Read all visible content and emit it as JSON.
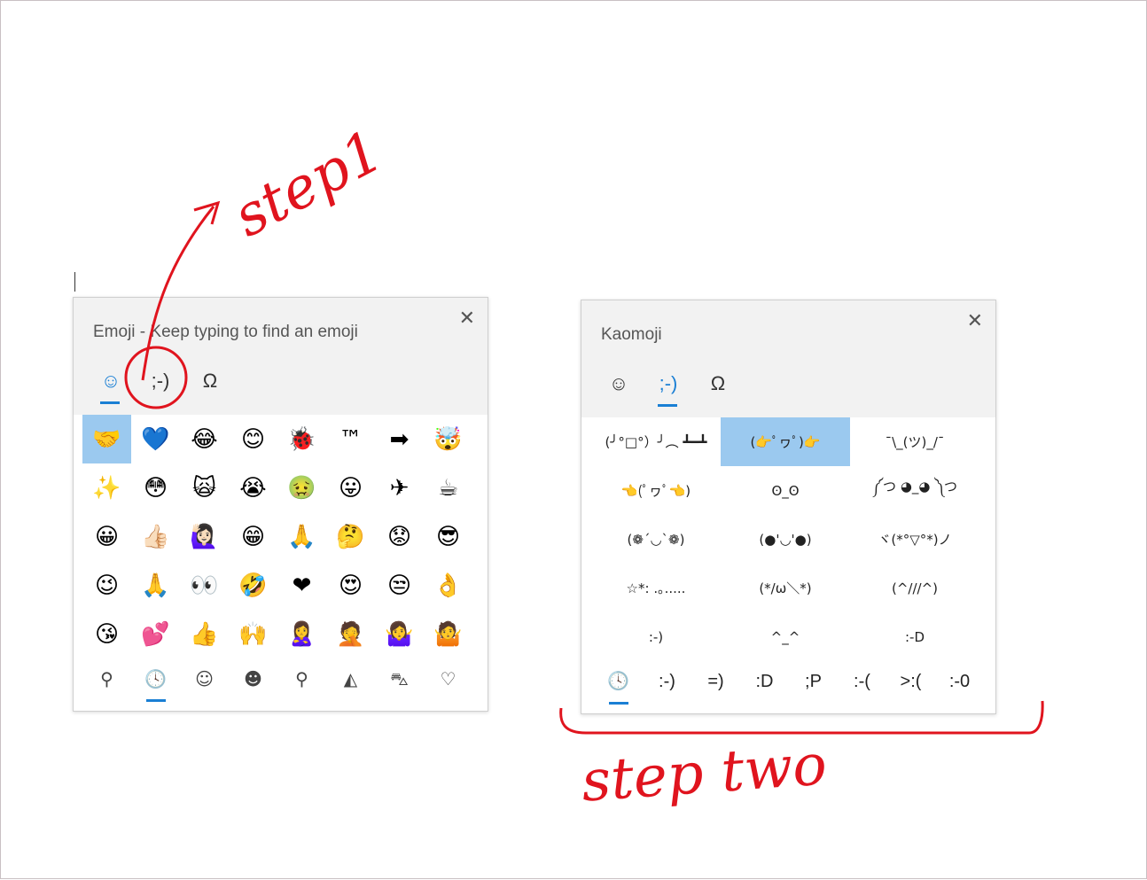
{
  "emoji_panel": {
    "title": "Emoji - Keep typing to find an emoji",
    "close_label": "✕",
    "tabs": [
      {
        "label": "☺",
        "icon": "smiley-icon",
        "active": true
      },
      {
        "label": ";-)",
        "icon": "kaomoji",
        "active": false
      },
      {
        "label": "Ω",
        "icon": "omega-symbols-icon",
        "active": false
      }
    ],
    "emojis": [
      "🤝",
      "💙",
      "😂",
      "😊",
      "🐞",
      "™",
      "➡",
      "🤯",
      "✨",
      "😳",
      "🙀",
      "😭",
      "🤢",
      "😛",
      "✈",
      "☕",
      "😀",
      "👍🏻",
      "🙋🏻‍♀️",
      "😁",
      "🙏",
      "🤔",
      "😟",
      "😎",
      "😉",
      "🙏",
      "👀",
      "🤣",
      "❤",
      "😍",
      "😒",
      "👌",
      "😘",
      "💕",
      "👍",
      "🙌",
      "🙎‍♀️",
      "🤦",
      "🤷‍♀️",
      "🤷"
    ],
    "selected_index": 0,
    "nav": [
      {
        "label": "⚲",
        "icon": "search-icon"
      },
      {
        "label": "🕓",
        "icon": "clock-icon",
        "active": true
      },
      {
        "label": "☺",
        "icon": "smiley-icon"
      },
      {
        "label": "☻",
        "icon": "person-icon"
      },
      {
        "label": "⚲",
        "icon": "location-pin-icon"
      },
      {
        "label": "◭",
        "icon": "pizza-icon"
      },
      {
        "label": "⛍",
        "icon": "car-icon"
      },
      {
        "label": "♡",
        "icon": "heart-icon"
      }
    ]
  },
  "kaomoji_panel": {
    "title": "Kaomoji",
    "close_label": "✕",
    "tabs": [
      {
        "label": "☺",
        "icon": "smiley-icon",
        "active": false
      },
      {
        "label": ";-)",
        "icon": "kaomoji",
        "active": true
      },
      {
        "label": "Ω",
        "icon": "omega-symbols-icon",
        "active": false
      }
    ],
    "items": [
      "(╯°□°）╯︵ ┻━┻",
      "(👉ﾟヮﾟ)👉",
      "¯\\_(ツ)_/¯",
      "👈(ﾟヮﾟ👈)",
      "ʘ‿ʘ",
      "༼つ ◕_◕ ༽つ",
      "(❁´◡`❁)",
      "(●'◡'●)",
      "ヾ(*°▽°*)ノ",
      "☆*: .｡. o(≧▽≦)o .｡.:*☆",
      "(*/ω＼*)",
      "(^///^)",
      ":-)",
      "^_^",
      ":-D"
    ],
    "items_display": [
      "(╯°□°）╯︵ ┻━┻",
      "(👉ﾟヮﾟ)👉",
      "¯\\_(ツ)_/¯",
      "👈(ﾟヮﾟ👈)",
      "ʘ_ʘ",
      "༼つ ◕_◕ ༽つ",
      "(❁´◡`❁)",
      "(●'◡'●)",
      "ヾ(*°▽°*)ノ",
      "☆*: .｡.....",
      "(*/ω＼*)",
      "(^///^)",
      ":-)",
      "^_^",
      ":-D"
    ],
    "selected_index": 1,
    "nav": [
      {
        "label": "🕓",
        "icon": "clock-icon",
        "active": true
      },
      {
        "label": ":-)"
      },
      {
        "label": "=)"
      },
      {
        "label": ":D"
      },
      {
        "label": ";P"
      },
      {
        "label": ":-("
      },
      {
        "label": ">:("
      },
      {
        "label": ":-0"
      }
    ]
  },
  "annotations": {
    "step1": "step1",
    "step2": "step two",
    "color": "#e0141e"
  },
  "colors": {
    "accent": "#1a7fd4",
    "selected": "#9bc9ef",
    "header": "#f2f2f2"
  }
}
